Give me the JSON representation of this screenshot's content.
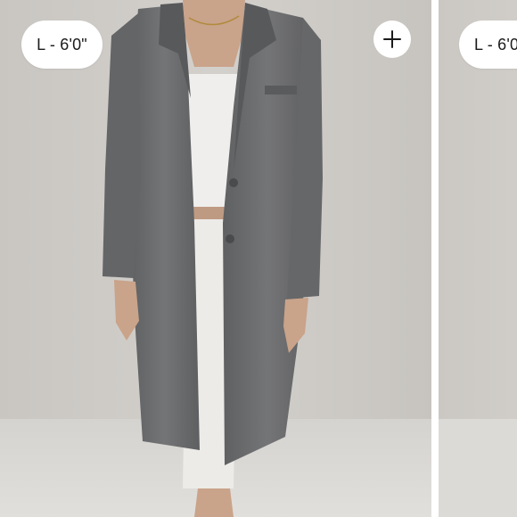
{
  "slides": [
    {
      "size_label": "L - 6'0\"",
      "image": "grey long blazer over white top and skirt"
    },
    {
      "size_label": "L - 6'0\"",
      "image": "partial view of next product photo"
    }
  ],
  "add_button": {
    "icon": "plus-icon"
  },
  "colors": {
    "backdrop": "#cdcac6",
    "blazer": "#6c6d6f",
    "top_and_skirt": "#efeeec",
    "badge_bg": "#ffffff",
    "badge_text": "#1a1a1a"
  }
}
